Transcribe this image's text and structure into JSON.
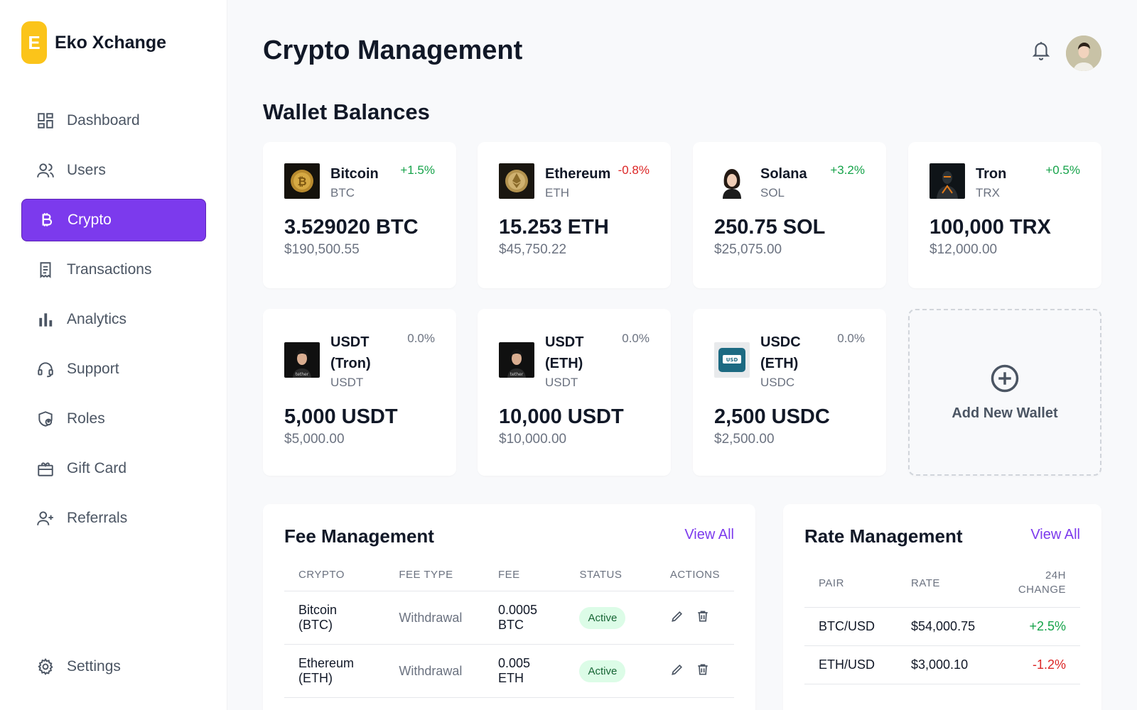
{
  "brand": {
    "logo_letter": "E",
    "name": "Eko Xchange"
  },
  "nav": [
    {
      "label": "Dashboard",
      "icon": "dashboard-icon"
    },
    {
      "label": "Users",
      "icon": "users-icon"
    },
    {
      "label": "Crypto",
      "icon": "bitcoin-icon",
      "active": true
    },
    {
      "label": "Transactions",
      "icon": "receipt-icon"
    },
    {
      "label": "Analytics",
      "icon": "bar-chart-icon"
    },
    {
      "label": "Support",
      "icon": "headset-icon"
    },
    {
      "label": "Roles",
      "icon": "shield-user-icon"
    },
    {
      "label": "Gift Card",
      "icon": "gift-card-icon"
    },
    {
      "label": "Referrals",
      "icon": "user-plus-icon"
    }
  ],
  "settings": {
    "label": "Settings",
    "icon": "gear-icon"
  },
  "header": {
    "title": "Crypto Management"
  },
  "wallets_section": {
    "title": "Wallet Balances"
  },
  "wallets": [
    {
      "name": "Bitcoin",
      "symbol": "BTC",
      "change": "+1.5%",
      "trend": "up",
      "balance": "3.529020 BTC",
      "usd": "$190,500.55"
    },
    {
      "name": "Ethereum",
      "symbol": "ETH",
      "change": "-0.8%",
      "trend": "down",
      "balance": "15.253 ETH",
      "usd": "$45,750.22"
    },
    {
      "name": "Solana",
      "symbol": "SOL",
      "change": "+3.2%",
      "trend": "up",
      "balance": "250.75 SOL",
      "usd": "$25,075.00"
    },
    {
      "name": "Tron",
      "symbol": "TRX",
      "change": "+0.5%",
      "trend": "up",
      "balance": "100,000 TRX",
      "usd": "$12,000.00"
    },
    {
      "name": "USDT (Tron)",
      "symbol": "USDT",
      "change": "0.0%",
      "trend": "flat",
      "balance": "5,000 USDT",
      "usd": "$5,000.00"
    },
    {
      "name": "USDT (ETH)",
      "symbol": "USDT",
      "change": "0.0%",
      "trend": "flat",
      "balance": "10,000 USDT",
      "usd": "$10,000.00"
    },
    {
      "name": "USDC (ETH)",
      "symbol": "USDC",
      "change": "0.0%",
      "trend": "flat",
      "balance": "2,500 USDC",
      "usd": "$2,500.00"
    }
  ],
  "add_wallet": {
    "label": "Add New Wallet"
  },
  "fee_management": {
    "title": "Fee Management",
    "view_all": "View All",
    "columns": [
      "CRYPTO",
      "FEE TYPE",
      "FEE",
      "STATUS",
      "ACTIONS"
    ],
    "rows": [
      {
        "crypto": "Bitcoin (BTC)",
        "fee_type": "Withdrawal",
        "fee": "0.0005 BTC",
        "status": "Active"
      },
      {
        "crypto": "Ethereum (ETH)",
        "fee_type": "Withdrawal",
        "fee": "0.005 ETH",
        "status": "Active"
      }
    ]
  },
  "rate_management": {
    "title": "Rate Management",
    "view_all": "View All",
    "columns": [
      "PAIR",
      "RATE",
      "24H CHANGE"
    ],
    "rows": [
      {
        "pair": "BTC/USD",
        "rate": "$54,000.75",
        "change": "+2.5%",
        "trend": "up"
      },
      {
        "pair": "ETH/USD",
        "rate": "$3,000.10",
        "change": "-1.2%",
        "trend": "down"
      }
    ]
  },
  "colors": {
    "accent": "#7c3aed",
    "brand": "#fbc41a",
    "positive": "#16a34a",
    "negative": "#dc2626",
    "badge_bg": "#dcfce7"
  }
}
